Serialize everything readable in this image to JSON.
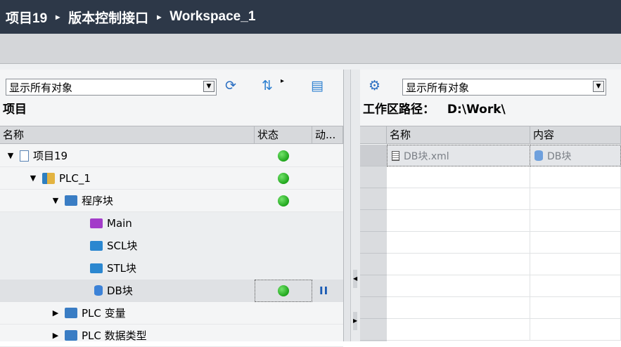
{
  "titlebar": {
    "crumbs": [
      "项目19",
      "版本控制接口",
      "Workspace_1"
    ],
    "sep": "▸"
  },
  "left": {
    "filter_value": "显示所有对象",
    "pane_title": "项目",
    "columns": {
      "name": "名称",
      "status": "状态",
      "action": "动..."
    },
    "tree": [
      {
        "label": "项目19",
        "icon": "project-icon",
        "status": "ok"
      },
      {
        "label": "PLC_1",
        "icon": "plc-icon",
        "status": "ok"
      },
      {
        "label": "程序块",
        "icon": "program-blocks-folder-icon",
        "status": "ok"
      },
      {
        "label": "Main",
        "icon": "ob-block-icon",
        "status": ""
      },
      {
        "label": "SCL块",
        "icon": "fb-block-icon",
        "status": ""
      },
      {
        "label": "STL块",
        "icon": "fb-block-icon",
        "status": ""
      },
      {
        "label": "DB块",
        "icon": "db-block-icon",
        "status": "ok",
        "action": "II"
      },
      {
        "label": "PLC 变量",
        "icon": "plc-tags-folder-icon",
        "status": ""
      },
      {
        "label": "PLC 数据类型",
        "icon": "plc-datatypes-folder-icon",
        "status": ""
      }
    ]
  },
  "right": {
    "filter_value": "显示所有对象",
    "path_label": "工作区路径：",
    "path_value": "D:\\Work\\",
    "columns": {
      "name": "名称",
      "content": "内容"
    },
    "rows": [
      {
        "name": "DB块.xml",
        "content": "DB块"
      }
    ]
  },
  "colors": {
    "titlebar": "#2d3848",
    "status_ok": "#1fa51c"
  }
}
